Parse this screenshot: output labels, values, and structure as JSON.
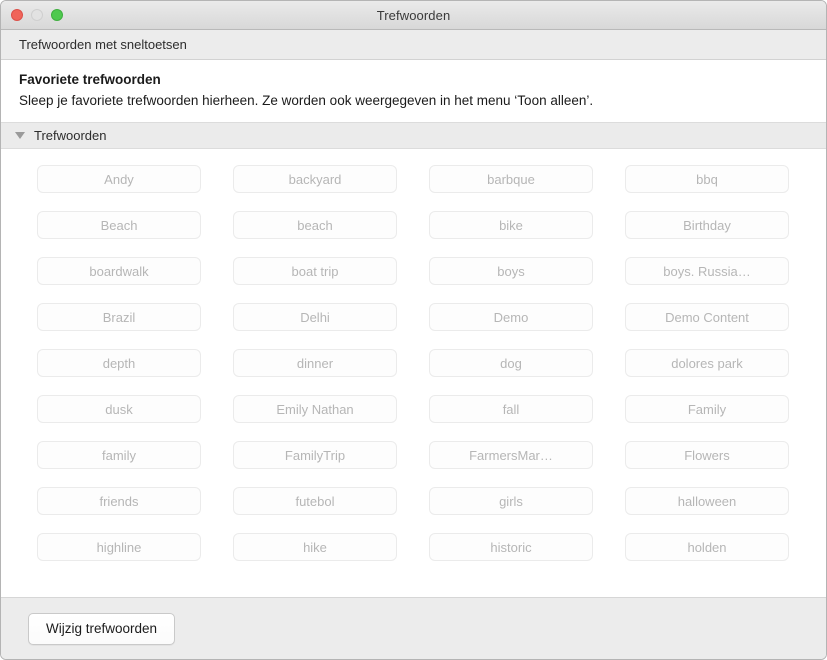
{
  "window": {
    "title": "Trefwoorden",
    "traffic_lights": {
      "close_label": "Sluiten",
      "minimize_label": "Minimaliseren",
      "zoom_label": "Zoomen"
    }
  },
  "header_strip": {
    "label": "Trefwoorden met sneltoetsen"
  },
  "favorites": {
    "title": "Favoriete trefwoorden",
    "description": "Sleep je favoriete trefwoorden hierheen. Ze worden ook weergegeven in het menu ‘Toon alleen’."
  },
  "section": {
    "label": "Trefwoorden",
    "disclosure_icon": "triangle-down-icon",
    "expanded": true
  },
  "keywords": [
    "Andy",
    "backyard",
    "barbque",
    "bbq",
    "Beach",
    "beach",
    "bike",
    "Birthday",
    "boardwalk",
    "boat trip",
    "boys",
    "boys. Russia…",
    "Brazil",
    "Delhi",
    "Demo",
    "Demo Content",
    "depth",
    "dinner",
    "dog",
    "dolores park",
    "dusk",
    "Emily Nathan",
    "fall",
    "Family",
    "family",
    "FamilyTrip",
    "FarmersMar…",
    "Flowers",
    "friends",
    "futebol",
    "girls",
    "halloween",
    "highline",
    "hike",
    "historic",
    "holden"
  ],
  "footer": {
    "edit_button_label": "Wijzig trefwoorden"
  },
  "colors": {
    "titlebar_top": "#eaeaea",
    "titlebar_bottom": "#d8d8d8",
    "close": "#f0655a",
    "minimize": "#e2e2e2",
    "zoom": "#4fc94f",
    "strip_bg": "#ececec",
    "section_bg": "#ebebeb",
    "pill_border": "#ebebeb",
    "pill_text": "#b6b6b6",
    "footer_bg": "#ececec",
    "body_text": "#1b1b1b"
  }
}
